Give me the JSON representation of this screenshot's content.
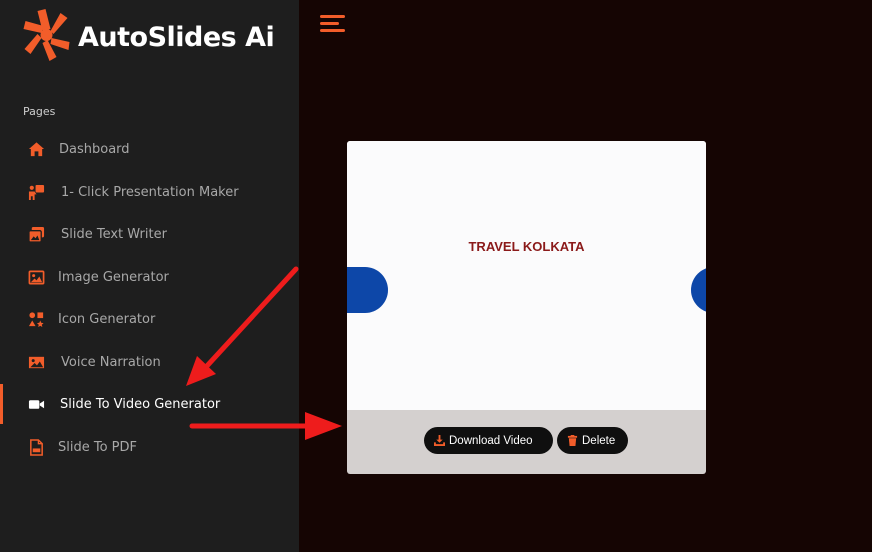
{
  "brand": {
    "name": "AutoSlides Ai",
    "icon": "starburst-logo",
    "accent": "#f25d2a"
  },
  "sidebar": {
    "section_title": "Pages",
    "items": [
      {
        "label": "Dashboard",
        "icon": "home-icon"
      },
      {
        "label": "1- Click Presentation Maker",
        "icon": "presenter-icon"
      },
      {
        "label": "Slide Text Writer",
        "icon": "images-icon"
      },
      {
        "label": "Image Generator",
        "icon": "image-icon"
      },
      {
        "label": "Icon Generator",
        "icon": "icons-icon"
      },
      {
        "label": "Voice Narration",
        "icon": "photo-icon"
      },
      {
        "label": "Slide To Video Generator",
        "icon": "video-camera-icon",
        "active": true
      },
      {
        "label": "Slide To PDF",
        "icon": "pdf-file-icon"
      }
    ]
  },
  "video_card": {
    "slide_title": "TRAVEL KOLKATA",
    "download_label": "Download Video",
    "delete_label": "Delete"
  },
  "colors": {
    "background": "#150503",
    "sidebar": "#1e1e1e",
    "accent": "#f25d2a",
    "annotation_arrow": "#ee1c1c"
  }
}
